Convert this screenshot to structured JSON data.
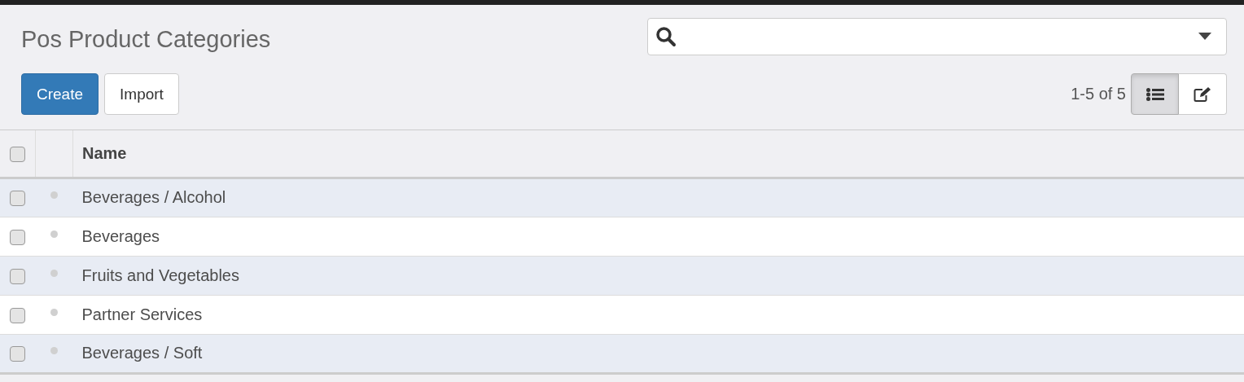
{
  "title": "Pos Product Categories",
  "buttons": [
    {
      "label": "Create",
      "kind": "primary"
    },
    {
      "label": "Import",
      "kind": "default"
    }
  ],
  "pager": "1-5 of 5",
  "views": [
    {
      "kind": "list",
      "selected": true
    },
    {
      "kind": "form",
      "selected": false
    }
  ],
  "table": {
    "select_all_checked": false,
    "columns": [
      "Name"
    ],
    "rows": [
      {
        "name": "Beverages / Alcohol",
        "checked": false
      },
      {
        "name": "Beverages",
        "checked": false
      },
      {
        "name": "Fruits and Vegetables",
        "checked": false
      },
      {
        "name": "Partner Services",
        "checked": false
      },
      {
        "name": "Beverages / Soft",
        "checked": false
      }
    ]
  }
}
